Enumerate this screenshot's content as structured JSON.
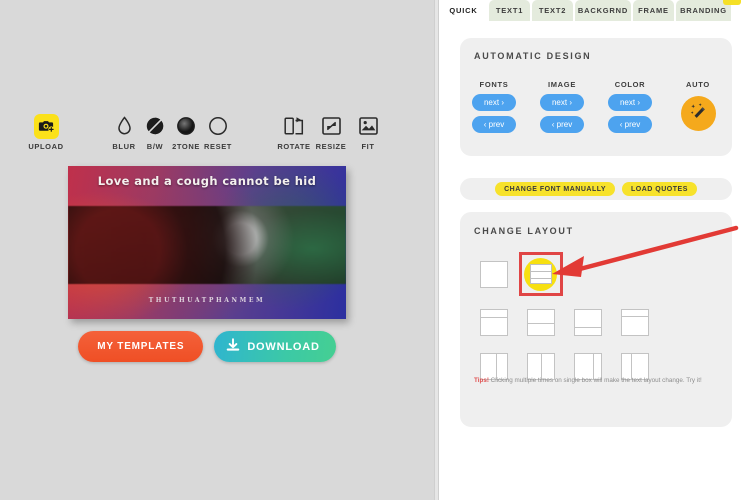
{
  "editor": {
    "toolbar": [
      {
        "id": "upload",
        "label": "UPLOAD",
        "icon": "camera-plus-icon"
      },
      {
        "id": "blur",
        "label": "BLUR",
        "icon": "droplet-icon"
      },
      {
        "id": "bw",
        "label": "B/W",
        "icon": "half-circle-icon"
      },
      {
        "id": "2tone",
        "label": "2TONE",
        "icon": "gradient-circle-icon"
      },
      {
        "id": "reset",
        "label": "RESET",
        "icon": "empty-circle-icon"
      },
      {
        "id": "rotate",
        "label": "ROTATE",
        "icon": "rotate-icon"
      },
      {
        "id": "resize",
        "label": "RESIZE",
        "icon": "resize-icon"
      },
      {
        "id": "fit",
        "label": "FIT",
        "icon": "fit-image-icon"
      }
    ],
    "card": {
      "quote": "Love and a cough cannot be hid",
      "branding": "THUTHUATPHANMEM"
    },
    "actions": {
      "templates_label": "MY TEMPLATES",
      "download_label": "DOWNLOAD",
      "download_icon": "download-icon"
    }
  },
  "sidebar": {
    "tabs": [
      {
        "label": "QUICK",
        "active": true
      },
      {
        "label": "TEXT1",
        "active": false
      },
      {
        "label": "TEXT2",
        "active": false
      },
      {
        "label": "BACKGRND",
        "active": false
      },
      {
        "label": "FRAME",
        "active": false
      },
      {
        "label": "BRANDING",
        "active": false
      }
    ],
    "automatic_design": {
      "title": "AUTOMATIC DESIGN",
      "columns": [
        {
          "label": "FONTS",
          "next": "next ›",
          "prev": "‹ prev"
        },
        {
          "label": "IMAGE",
          "next": "next ›",
          "prev": "‹ prev"
        },
        {
          "label": "COLOR",
          "next": "next ›",
          "prev": "‹ prev"
        }
      ],
      "auto": {
        "label": "AUTO",
        "icon": "magic-wand-icon"
      }
    },
    "quick_actions": [
      {
        "label": "CHANGE FONT MANUALLY"
      },
      {
        "label": "LOAD QUOTES"
      }
    ],
    "change_layout": {
      "title": "CHANGE LAYOUT",
      "rows": [
        [
          {
            "id": "blank",
            "type": "plain",
            "selected": false
          },
          {
            "id": "selected",
            "type": "selected",
            "selected": true
          }
        ],
        [
          {
            "id": "h-top-thin",
            "type": "h-split",
            "ratio": 30
          },
          {
            "id": "h-top-mid",
            "type": "h-split",
            "ratio": 52
          },
          {
            "id": "h-top-large",
            "type": "h-split",
            "ratio": 68
          },
          {
            "id": "h-top-small",
            "type": "h-split",
            "ratio": 26
          }
        ],
        [
          {
            "id": "v-left-wide",
            "type": "v-split",
            "ratio": 58
          },
          {
            "id": "v-left-mid",
            "type": "v-split",
            "ratio": 50
          },
          {
            "id": "v-left-large",
            "type": "v-split",
            "ratio": 72
          },
          {
            "id": "v-left-small",
            "type": "v-split",
            "ratio": 38
          }
        ]
      ],
      "tips_prefix": "Tips!",
      "tips_text": " Clicking multiple times on single box will make the text layout change. Try it!"
    }
  },
  "annotation": {
    "arrow": "red-arrow-pointing-to-selected-layout"
  },
  "colors": {
    "accent_yellow": "#f7e22b",
    "accent_blue": "#4da3ef",
    "accent_orange": "#ef4f25",
    "accent_teal": "#3cc9a6",
    "selection_red": "#e04545",
    "auto_amber": "#f5a91c"
  }
}
